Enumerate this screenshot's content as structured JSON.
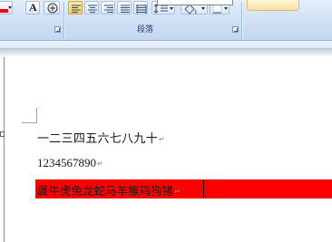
{
  "ribbon": {
    "paragraph_group_label": "段落",
    "font_button_letter": "A",
    "colors": {
      "font_color_swatch": "#ff0000",
      "highlight_active": "#ffd05c"
    }
  },
  "document": {
    "lines": [
      {
        "text": "一二三四五六七八九十",
        "mark": "↵"
      },
      {
        "text": "1234567890",
        "mark": "↵"
      },
      {
        "text": "属牛虎兔龙蛇马羊猴鸡狗猪",
        "mark": "↵",
        "highlight": "#ff0000"
      }
    ]
  }
}
